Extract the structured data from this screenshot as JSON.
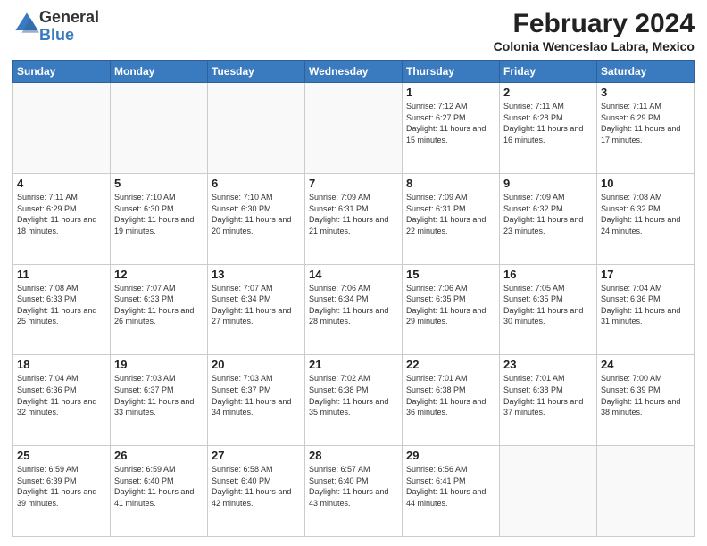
{
  "header": {
    "logo_general": "General",
    "logo_blue": "Blue",
    "title": "February 2024",
    "subtitle": "Colonia Wenceslao Labra, Mexico"
  },
  "days_of_week": [
    "Sunday",
    "Monday",
    "Tuesday",
    "Wednesday",
    "Thursday",
    "Friday",
    "Saturday"
  ],
  "weeks": [
    [
      {
        "day": "",
        "info": ""
      },
      {
        "day": "",
        "info": ""
      },
      {
        "day": "",
        "info": ""
      },
      {
        "day": "",
        "info": ""
      },
      {
        "day": "1",
        "info": "Sunrise: 7:12 AM\nSunset: 6:27 PM\nDaylight: 11 hours and 15 minutes."
      },
      {
        "day": "2",
        "info": "Sunrise: 7:11 AM\nSunset: 6:28 PM\nDaylight: 11 hours and 16 minutes."
      },
      {
        "day": "3",
        "info": "Sunrise: 7:11 AM\nSunset: 6:29 PM\nDaylight: 11 hours and 17 minutes."
      }
    ],
    [
      {
        "day": "4",
        "info": "Sunrise: 7:11 AM\nSunset: 6:29 PM\nDaylight: 11 hours and 18 minutes."
      },
      {
        "day": "5",
        "info": "Sunrise: 7:10 AM\nSunset: 6:30 PM\nDaylight: 11 hours and 19 minutes."
      },
      {
        "day": "6",
        "info": "Sunrise: 7:10 AM\nSunset: 6:30 PM\nDaylight: 11 hours and 20 minutes."
      },
      {
        "day": "7",
        "info": "Sunrise: 7:09 AM\nSunset: 6:31 PM\nDaylight: 11 hours and 21 minutes."
      },
      {
        "day": "8",
        "info": "Sunrise: 7:09 AM\nSunset: 6:31 PM\nDaylight: 11 hours and 22 minutes."
      },
      {
        "day": "9",
        "info": "Sunrise: 7:09 AM\nSunset: 6:32 PM\nDaylight: 11 hours and 23 minutes."
      },
      {
        "day": "10",
        "info": "Sunrise: 7:08 AM\nSunset: 6:32 PM\nDaylight: 11 hours and 24 minutes."
      }
    ],
    [
      {
        "day": "11",
        "info": "Sunrise: 7:08 AM\nSunset: 6:33 PM\nDaylight: 11 hours and 25 minutes."
      },
      {
        "day": "12",
        "info": "Sunrise: 7:07 AM\nSunset: 6:33 PM\nDaylight: 11 hours and 26 minutes."
      },
      {
        "day": "13",
        "info": "Sunrise: 7:07 AM\nSunset: 6:34 PM\nDaylight: 11 hours and 27 minutes."
      },
      {
        "day": "14",
        "info": "Sunrise: 7:06 AM\nSunset: 6:34 PM\nDaylight: 11 hours and 28 minutes."
      },
      {
        "day": "15",
        "info": "Sunrise: 7:06 AM\nSunset: 6:35 PM\nDaylight: 11 hours and 29 minutes."
      },
      {
        "day": "16",
        "info": "Sunrise: 7:05 AM\nSunset: 6:35 PM\nDaylight: 11 hours and 30 minutes."
      },
      {
        "day": "17",
        "info": "Sunrise: 7:04 AM\nSunset: 6:36 PM\nDaylight: 11 hours and 31 minutes."
      }
    ],
    [
      {
        "day": "18",
        "info": "Sunrise: 7:04 AM\nSunset: 6:36 PM\nDaylight: 11 hours and 32 minutes."
      },
      {
        "day": "19",
        "info": "Sunrise: 7:03 AM\nSunset: 6:37 PM\nDaylight: 11 hours and 33 minutes."
      },
      {
        "day": "20",
        "info": "Sunrise: 7:03 AM\nSunset: 6:37 PM\nDaylight: 11 hours and 34 minutes."
      },
      {
        "day": "21",
        "info": "Sunrise: 7:02 AM\nSunset: 6:38 PM\nDaylight: 11 hours and 35 minutes."
      },
      {
        "day": "22",
        "info": "Sunrise: 7:01 AM\nSunset: 6:38 PM\nDaylight: 11 hours and 36 minutes."
      },
      {
        "day": "23",
        "info": "Sunrise: 7:01 AM\nSunset: 6:38 PM\nDaylight: 11 hours and 37 minutes."
      },
      {
        "day": "24",
        "info": "Sunrise: 7:00 AM\nSunset: 6:39 PM\nDaylight: 11 hours and 38 minutes."
      }
    ],
    [
      {
        "day": "25",
        "info": "Sunrise: 6:59 AM\nSunset: 6:39 PM\nDaylight: 11 hours and 39 minutes."
      },
      {
        "day": "26",
        "info": "Sunrise: 6:59 AM\nSunset: 6:40 PM\nDaylight: 11 hours and 41 minutes."
      },
      {
        "day": "27",
        "info": "Sunrise: 6:58 AM\nSunset: 6:40 PM\nDaylight: 11 hours and 42 minutes."
      },
      {
        "day": "28",
        "info": "Sunrise: 6:57 AM\nSunset: 6:40 PM\nDaylight: 11 hours and 43 minutes."
      },
      {
        "day": "29",
        "info": "Sunrise: 6:56 AM\nSunset: 6:41 PM\nDaylight: 11 hours and 44 minutes."
      },
      {
        "day": "",
        "info": ""
      },
      {
        "day": "",
        "info": ""
      }
    ]
  ]
}
